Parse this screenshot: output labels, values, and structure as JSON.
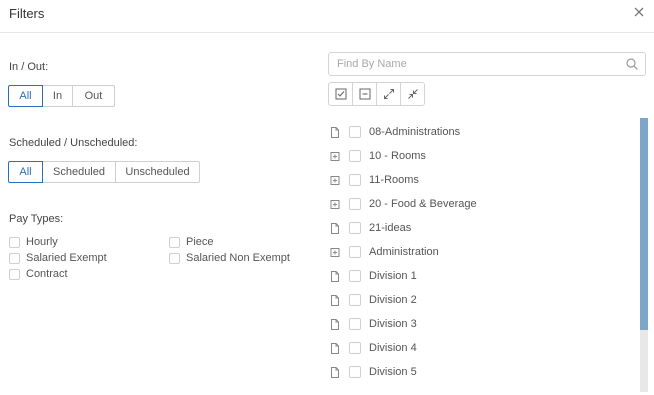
{
  "dialog": {
    "title": "Filters"
  },
  "in_out": {
    "label": "In / Out:",
    "options": [
      "All",
      "In",
      "Out"
    ],
    "selected": "All"
  },
  "scheduled": {
    "label": "Scheduled / Unscheduled:",
    "options": [
      "All",
      "Scheduled",
      "Unscheduled"
    ],
    "selected": "All"
  },
  "pay_types": {
    "label": "Pay Types:",
    "items": [
      "Hourly",
      "Piece",
      "Salaried Exempt",
      "Salaried Non Exempt",
      "Contract"
    ]
  },
  "search": {
    "placeholder": "Find By Name",
    "value": ""
  },
  "tree_toolbar": {
    "buttons": [
      "check-all-icon",
      "uncheck-all-icon",
      "expand-all-icon",
      "collapse-all-icon"
    ]
  },
  "tree": {
    "items": [
      {
        "label": "08-Administrations",
        "type": "leaf"
      },
      {
        "label": "10 - Rooms",
        "type": "expandable"
      },
      {
        "label": "11-Rooms",
        "type": "expandable"
      },
      {
        "label": "20 - Food & Beverage",
        "type": "expandable"
      },
      {
        "label": "21-ideas",
        "type": "leaf"
      },
      {
        "label": "Administration",
        "type": "expandable"
      },
      {
        "label": "Division 1",
        "type": "leaf"
      },
      {
        "label": "Division 2",
        "type": "leaf"
      },
      {
        "label": "Division 3",
        "type": "leaf"
      },
      {
        "label": "Division 4",
        "type": "leaf"
      },
      {
        "label": "Division 5",
        "type": "leaf"
      }
    ]
  },
  "colors": {
    "accent": "#2a6fb8",
    "scrollbar": "#7ea6c9",
    "border": "#cfcfcf"
  }
}
